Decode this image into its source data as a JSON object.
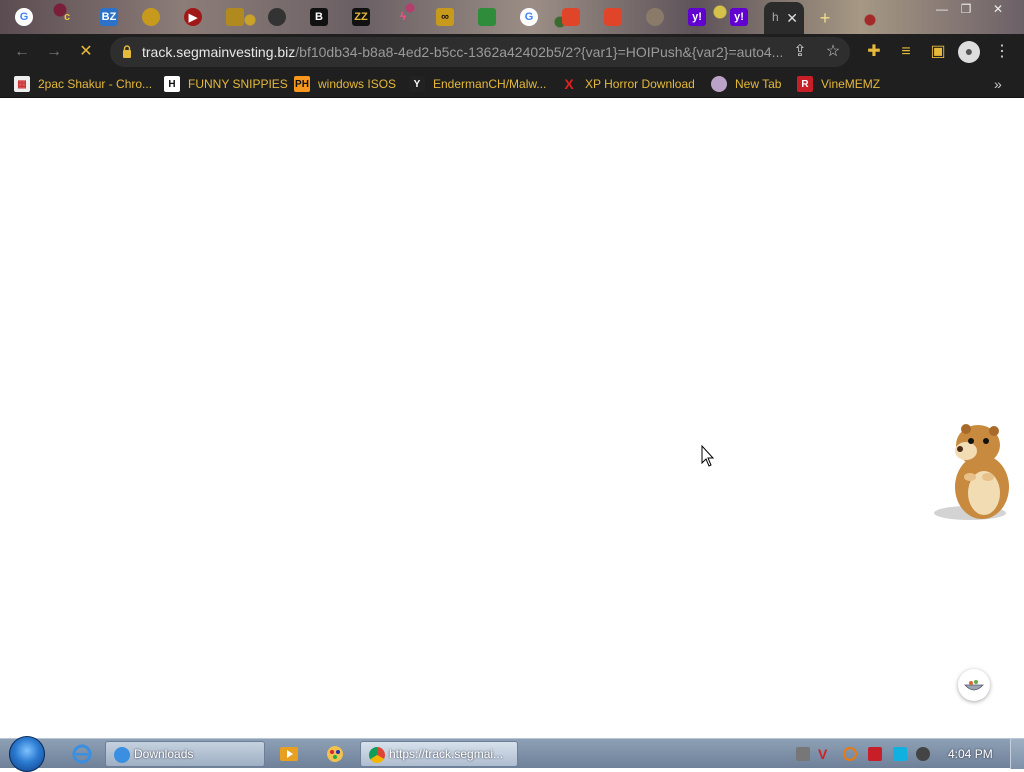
{
  "browser": {
    "active_tab_title": "h",
    "close_tab_glyph": "✕",
    "url_host": "track.segmainvesting.biz",
    "url_path": "/bf10db34-b8a8-4ed2-b5cc-1362a42402b5/2?{var1}=HOIPush&{var2}=auto4...",
    "tab_icons": [
      "google-icon",
      "c-icon",
      "bz-icon",
      "gold-icon",
      "play-icon",
      "gold-icon",
      "mask-icon",
      "bold-b-icon",
      "zz-icon",
      "pink-icon",
      "infinity-icon",
      "lock-green-icon",
      "google-icon",
      "brave-icon",
      "brave-icon",
      "avatar-icon",
      "yahoo-icon",
      "yahoo-icon"
    ]
  },
  "bookmarks": [
    {
      "label": "2pac Shakur - Chro...",
      "icon": "calendar-icon"
    },
    {
      "label": "FUNNY SNIPPIES",
      "icon": "h-icon"
    },
    {
      "label": "windows ISOS",
      "icon": "ph-icon"
    },
    {
      "label": "EndermanCH/Malw...",
      "icon": "yp-icon"
    },
    {
      "label": "XP Horror Download",
      "icon": "x-icon"
    },
    {
      "label": "New Tab",
      "icon": "globe-icon"
    },
    {
      "label": "VineMEMZ",
      "icon": "r-icon"
    }
  ],
  "taskbar": {
    "downloads_label": "Downloads",
    "chrome_label": "https://track.segmai...",
    "clock": "4:04 PM"
  },
  "colors": {
    "bookmark_text": "#e5b93a",
    "chrome_dark": "#1f1f1f",
    "taskbar": "#7f92aa"
  }
}
